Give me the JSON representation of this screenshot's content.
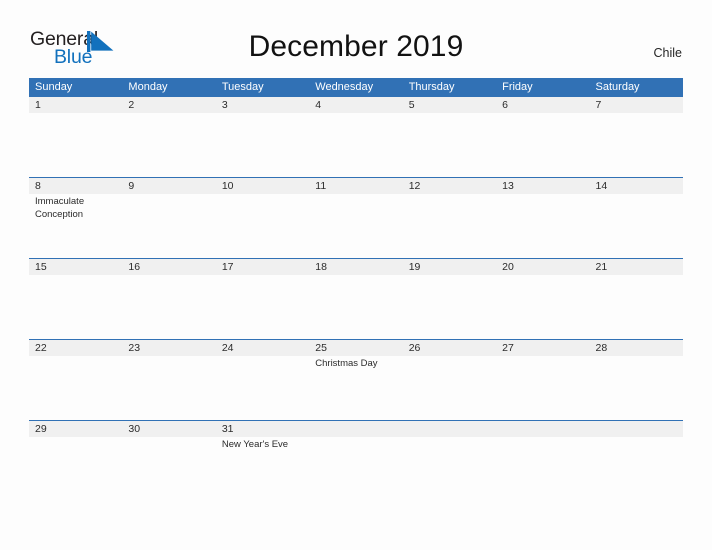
{
  "brand": {
    "name_part1": "General",
    "name_part2": "Blue",
    "flag_icon": "triangle-flag-icon",
    "blue": "#1271bd",
    "dark": "#231f20"
  },
  "header": {
    "title": "December 2019",
    "country": "Chile"
  },
  "theme": {
    "header_blue": "#3171b5",
    "band_gray": "#f0f0f0",
    "page_background": "#fdfdfd",
    "text": "#2b2b2b"
  },
  "calendar": {
    "weekdays": [
      "Sunday",
      "Monday",
      "Tuesday",
      "Wednesday",
      "Thursday",
      "Friday",
      "Saturday"
    ],
    "weeks": [
      [
        {
          "date": "1",
          "event": ""
        },
        {
          "date": "2",
          "event": ""
        },
        {
          "date": "3",
          "event": ""
        },
        {
          "date": "4",
          "event": ""
        },
        {
          "date": "5",
          "event": ""
        },
        {
          "date": "6",
          "event": ""
        },
        {
          "date": "7",
          "event": ""
        }
      ],
      [
        {
          "date": "8",
          "event": "Immaculate Conception"
        },
        {
          "date": "9",
          "event": ""
        },
        {
          "date": "10",
          "event": ""
        },
        {
          "date": "11",
          "event": ""
        },
        {
          "date": "12",
          "event": ""
        },
        {
          "date": "13",
          "event": ""
        },
        {
          "date": "14",
          "event": ""
        }
      ],
      [
        {
          "date": "15",
          "event": ""
        },
        {
          "date": "16",
          "event": ""
        },
        {
          "date": "17",
          "event": ""
        },
        {
          "date": "18",
          "event": ""
        },
        {
          "date": "19",
          "event": ""
        },
        {
          "date": "20",
          "event": ""
        },
        {
          "date": "21",
          "event": ""
        }
      ],
      [
        {
          "date": "22",
          "event": ""
        },
        {
          "date": "23",
          "event": ""
        },
        {
          "date": "24",
          "event": ""
        },
        {
          "date": "25",
          "event": "Christmas Day"
        },
        {
          "date": "26",
          "event": ""
        },
        {
          "date": "27",
          "event": ""
        },
        {
          "date": "28",
          "event": ""
        }
      ],
      [
        {
          "date": "29",
          "event": ""
        },
        {
          "date": "30",
          "event": ""
        },
        {
          "date": "31",
          "event": "New Year's Eve"
        },
        {
          "date": "",
          "event": ""
        },
        {
          "date": "",
          "event": ""
        },
        {
          "date": "",
          "event": ""
        },
        {
          "date": "",
          "event": ""
        }
      ]
    ]
  }
}
